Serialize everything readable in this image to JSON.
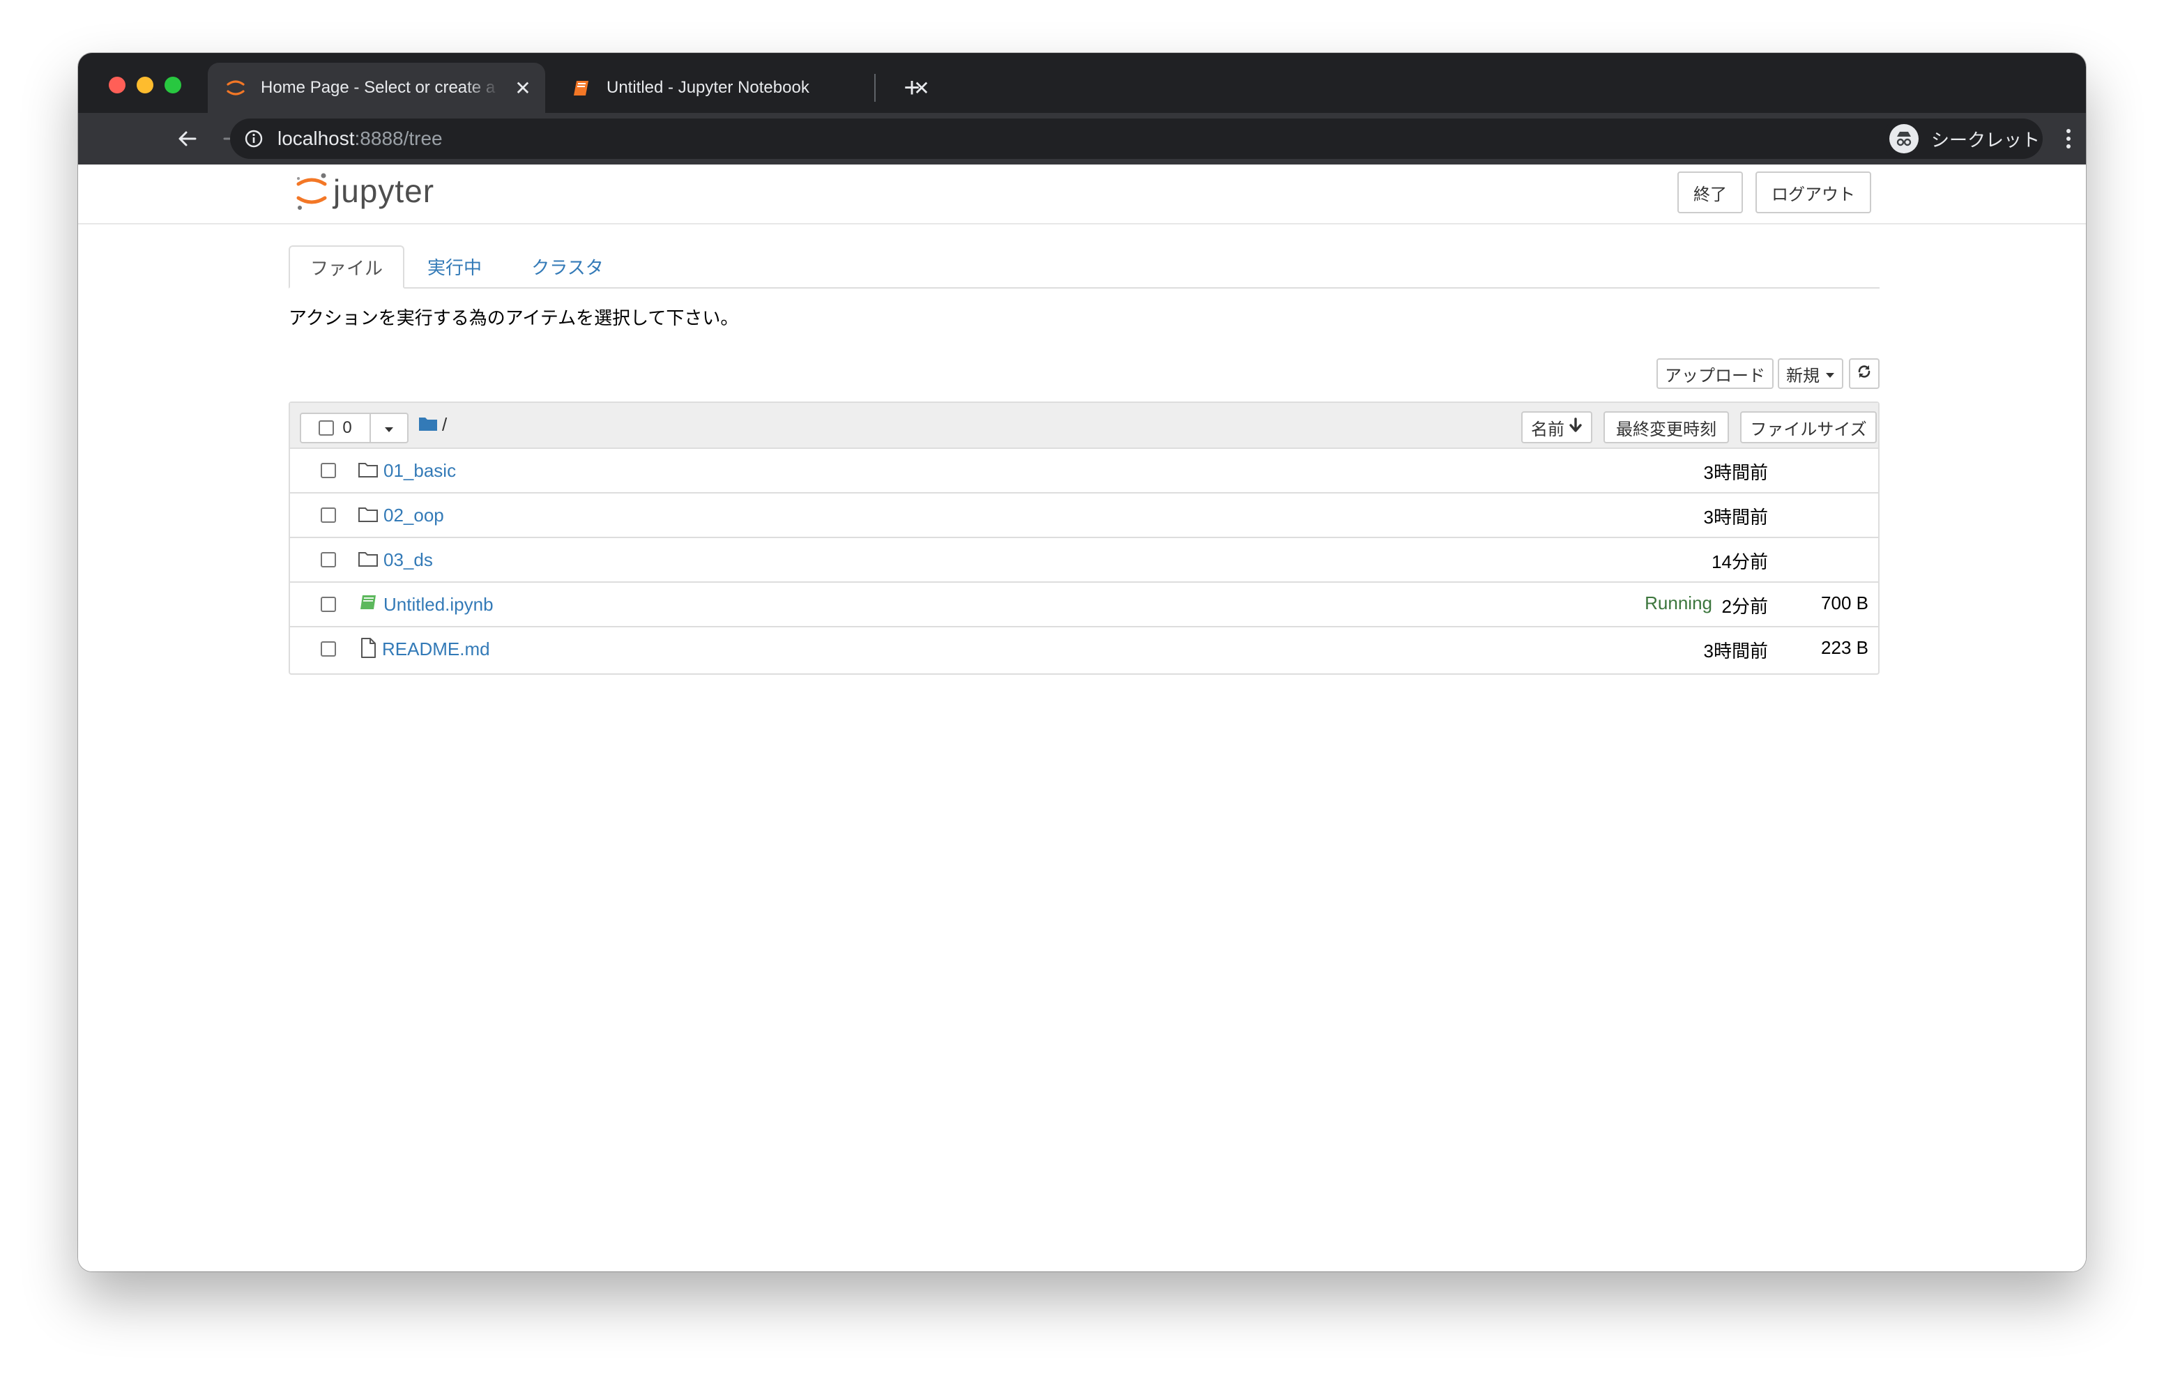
{
  "browser": {
    "tabs": [
      {
        "title": "Home Page - Select or create a notebook",
        "active": true
      },
      {
        "title": "Untitled - Jupyter Notebook",
        "active": false
      }
    ],
    "url_host": "localhost",
    "url_rest": ":8888/tree",
    "profile_label": "シークレット"
  },
  "jupyter": {
    "logo_text": "jupyter",
    "quit_label": "終了",
    "logout_label": "ログアウト",
    "nav_tabs": [
      "ファイル",
      "実行中",
      "クラスタ"
    ],
    "instruction": "アクションを実行する為のアイテムを選択して下さい。",
    "upload_label": "アップロード",
    "new_label": "新規",
    "selected_count": "0",
    "breadcrumb_path": "/",
    "columns": {
      "name": "名前",
      "last_modified": "最終変更時刻",
      "file_size": "ファイルサイズ"
    },
    "items": [
      {
        "name": "01_basic",
        "type": "folder",
        "status": "",
        "modified": "3時間前",
        "size": ""
      },
      {
        "name": "02_oop",
        "type": "folder",
        "status": "",
        "modified": "3時間前",
        "size": ""
      },
      {
        "name": "03_ds",
        "type": "folder",
        "status": "",
        "modified": "14分前",
        "size": ""
      },
      {
        "name": "Untitled.ipynb",
        "type": "notebook",
        "status": "Running",
        "modified": "2分前",
        "size": "700 B"
      },
      {
        "name": "README.md",
        "type": "file",
        "status": "",
        "modified": "3時間前",
        "size": "223 B"
      }
    ]
  },
  "colors": {
    "link": "#337ab7",
    "running": "#3c763d",
    "jupyter_orange": "#f37726",
    "chrome_dark": "#202124",
    "chrome_toolbar": "#35363a"
  }
}
